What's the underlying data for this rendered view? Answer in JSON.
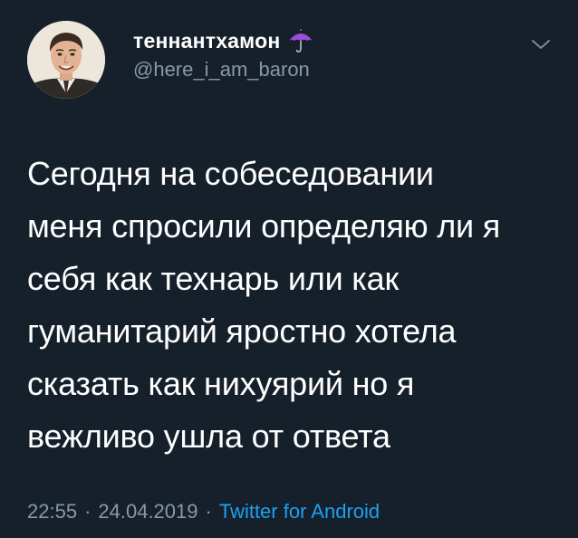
{
  "tweet": {
    "author": {
      "display_name": "теннантхамон",
      "handle": "@here_i_am_baron",
      "badge_icon": "umbrella-icon",
      "avatar_icon": "avatar"
    },
    "menu_icon": "chevron-down-icon",
    "text": "Сегодня на собеседовании\nменя спросили определяю ли я\nсебя как технарь или как\nгуманитарий яростно хотела\nсказать как нихуярий но я\nвежливо ушла от ответа",
    "meta": {
      "time": "22:55",
      "separator": "·",
      "date": "24.04.2019",
      "source": "Twitter for Android"
    }
  },
  "colors": {
    "background": "#15202b",
    "text": "#ffffff",
    "secondary": "#8899a6",
    "link": "#1da1f2",
    "umbrella": "#9b4fd6"
  }
}
